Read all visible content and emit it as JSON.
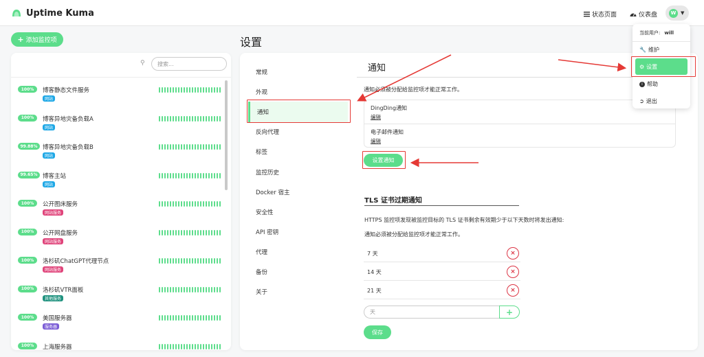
{
  "app": {
    "brand": "Uptime Kuma"
  },
  "header": {
    "status_page": "状态页面",
    "dashboard": "仪表盘",
    "avatar_letter": "W"
  },
  "sidebar_actions": {
    "add_monitor": "添加监控项",
    "search_placeholder": "搜索..."
  },
  "monitors": [
    {
      "uptime": "100%",
      "name": "博客静态文件服务",
      "tag": "网站",
      "tag_color": "#1fa8e6"
    },
    {
      "uptime": "100%",
      "name": "博客异地灾备负载A",
      "tag": "网站",
      "tag_color": "#1fa8e6"
    },
    {
      "uptime": "99.88%",
      "name": "博客异地灾备负载B",
      "tag": "网站",
      "tag_color": "#1fa8e6"
    },
    {
      "uptime": "99.65%",
      "name": "博客主站",
      "tag": "网站",
      "tag_color": "#1fa8e6"
    },
    {
      "uptime": "100%",
      "name": "公开图床服务",
      "tag": "网站服务",
      "tag_color": "#e0457b"
    },
    {
      "uptime": "100%",
      "name": "公开网盘服务",
      "tag": "网站服务",
      "tag_color": "#e0457b"
    },
    {
      "uptime": "100%",
      "name": "洛杉矶ChatGPT代理节点",
      "tag": "网站服务",
      "tag_color": "#e0457b"
    },
    {
      "uptime": "100%",
      "name": "洛杉矶VTR面板",
      "tag": "其他服务",
      "tag_color": "#20927f"
    },
    {
      "uptime": "100%",
      "name": "美国服务器",
      "tag": "服务器",
      "tag_color": "#7b5cd6"
    },
    {
      "uptime": "100%",
      "name": "上海服务器",
      "tag": "",
      "tag_color": "#7b5cd6"
    }
  ],
  "settings": {
    "title": "设置",
    "menu": [
      "常规",
      "外观",
      "通知",
      "反向代理",
      "标签",
      "监控历史",
      "Docker 宿主",
      "安全性",
      "API 密钥",
      "代理",
      "备份",
      "关于"
    ],
    "active_menu": "通知",
    "notifications": {
      "heading": "通知",
      "note": "通知必须被分配给监控项才能正常工作。",
      "items": [
        {
          "name": "DingDing通知",
          "edit": "编辑"
        },
        {
          "name": "电子邮件通知",
          "edit": "编辑"
        }
      ],
      "setup_button": "设置通知"
    },
    "tls": {
      "heading": "TLS 证书过期通知",
      "desc": "HTTPS 监控项发现被监控目标的 TLS 证书剩余有效期少于以下天数时将发出通知:",
      "note": "通知必须被分配给监控项才能正常工作。",
      "days": [
        "7 天",
        "14 天",
        "21 天"
      ],
      "input_placeholder": "天",
      "add_label": "+",
      "remove_label": "×",
      "save_button": "保存"
    }
  },
  "user_menu": {
    "current_user_label": "当前用户:",
    "username": "will",
    "items": [
      {
        "label": "维护",
        "icon": "wrench-icon"
      },
      {
        "label": "设置",
        "icon": "gear-icon"
      },
      {
        "label": "帮助",
        "icon": "info-icon"
      },
      {
        "label": "退出",
        "icon": "logout-icon"
      }
    ]
  },
  "colors": {
    "accent": "#5cdd8b",
    "highlight": "#e53935",
    "danger": "#dc3545"
  }
}
